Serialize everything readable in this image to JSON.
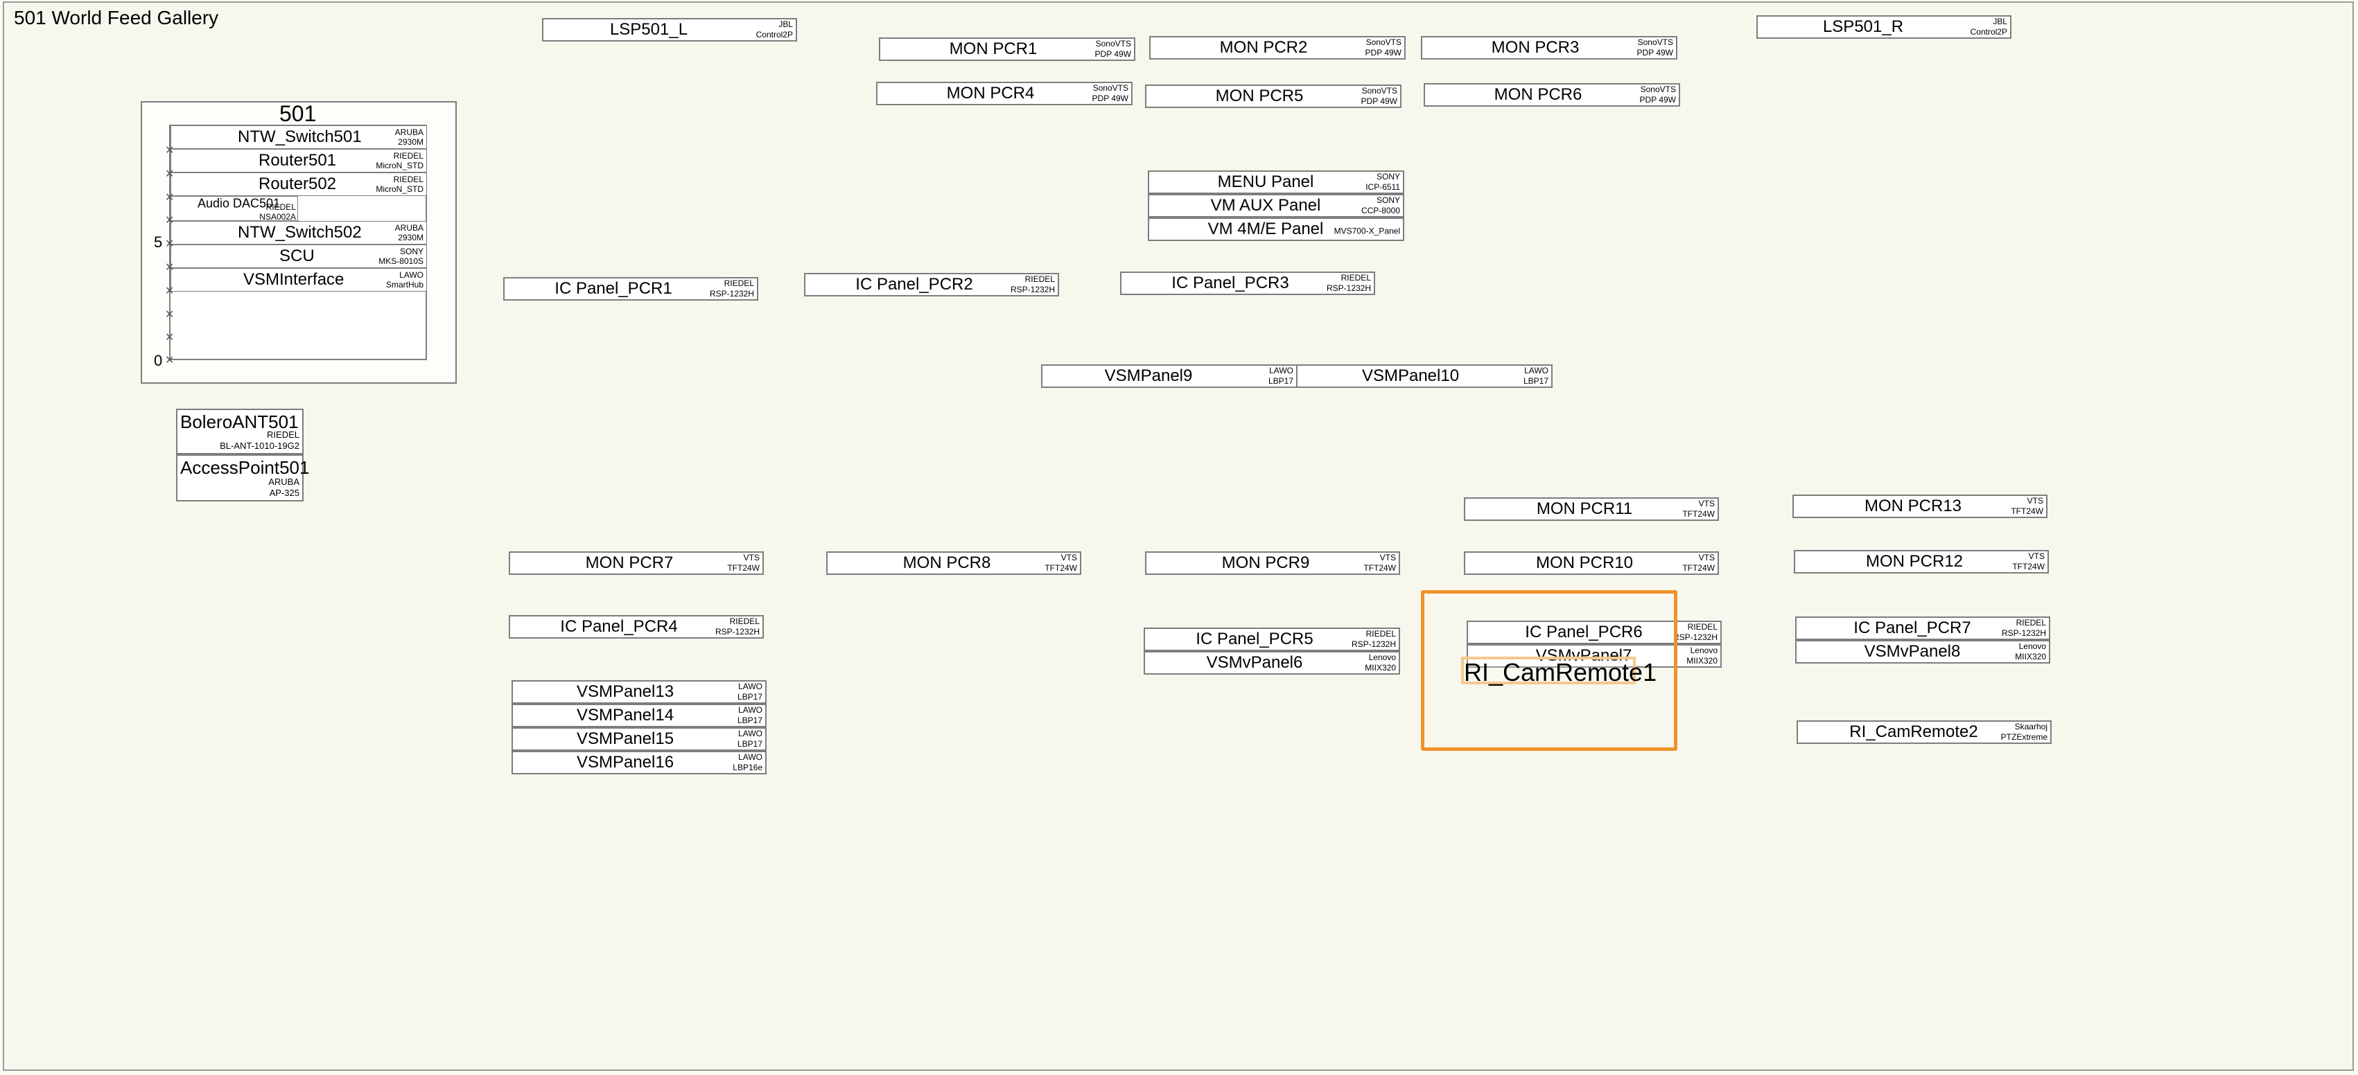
{
  "title": "501 World Feed Gallery",
  "accent_color": "#f0912c",
  "rack": {
    "title": "501",
    "units": [
      {
        "name": "NTW_Switch501",
        "mf1": "ARUBA",
        "mf2": "2930M"
      },
      {
        "name": "Router501",
        "mf1": "RIEDEL",
        "mf2": "MicroN_STD"
      },
      {
        "name": "Router502",
        "mf1": "RIEDEL",
        "mf2": "MicroN_STD"
      },
      {
        "name": "Audio DAC501",
        "mf1": "RIEDEL",
        "mf2": "NSA002A"
      },
      {
        "name": "NTW_Switch502",
        "mf1": "ARUBA",
        "mf2": "2930M"
      },
      {
        "name": "SCU",
        "mf1": "SONY",
        "mf2": "MKS-8010S"
      },
      {
        "name": "VSMInterface",
        "mf1": "LAWO",
        "mf2": "SmartHub"
      }
    ],
    "label_5": "5",
    "label_0": "0"
  },
  "devices": {
    "lsp_l": {
      "name": "LSP501_L",
      "mf1": "JBL",
      "mf2": "Control2P"
    },
    "lsp_r": {
      "name": "LSP501_R",
      "mf1": "JBL",
      "mf2": "Control2P"
    },
    "mon1": {
      "name": "MON PCR1",
      "mf1": "SonoVTS",
      "mf2": "PDP 49W"
    },
    "mon2": {
      "name": "MON PCR2",
      "mf1": "SonoVTS",
      "mf2": "PDP 49W"
    },
    "mon3": {
      "name": "MON PCR3",
      "mf1": "SonoVTS",
      "mf2": "PDP 49W"
    },
    "mon4": {
      "name": "MON PCR4",
      "mf1": "SonoVTS",
      "mf2": "PDP 49W"
    },
    "mon5": {
      "name": "MON PCR5",
      "mf1": "SonoVTS",
      "mf2": "PDP 49W"
    },
    "mon6": {
      "name": "MON PCR6",
      "mf1": "SonoVTS",
      "mf2": "PDP 49W"
    },
    "menu": {
      "name": "MENU Panel",
      "mf1": "SONY",
      "mf2": "ICP-6511"
    },
    "vmaux": {
      "name": "VM AUX Panel",
      "mf1": "SONY",
      "mf2": "CCP-8000"
    },
    "vm4me": {
      "name": "VM 4M/E Panel",
      "mf1": "",
      "mf2": "MVS700-X_Panel"
    },
    "ic1": {
      "name": "IC Panel_PCR1",
      "mf1": "RIEDEL",
      "mf2": "RSP-1232H"
    },
    "ic2": {
      "name": "IC Panel_PCR2",
      "mf1": "RIEDEL",
      "mf2": "RSP-1232H"
    },
    "ic3": {
      "name": "IC Panel_PCR3",
      "mf1": "RIEDEL",
      "mf2": "RSP-1232H"
    },
    "vsm9": {
      "name": "VSMPanel9",
      "mf1": "LAWO",
      "mf2": "LBP17"
    },
    "vsm10": {
      "name": "VSMPanel10",
      "mf1": "LAWO",
      "mf2": "LBP17"
    },
    "bolero": {
      "name": "BoleroANT501",
      "mf1": "RIEDEL",
      "mf2": "BL-ANT-1010-19G2"
    },
    "ap": {
      "name": "AccessPoint501",
      "mf1": "ARUBA",
      "mf2": "AP-325"
    },
    "mon11": {
      "name": "MON PCR11",
      "mf1": "VTS",
      "mf2": "TFT24W"
    },
    "mon13": {
      "name": "MON PCR13",
      "mf1": "VTS",
      "mf2": "TFT24W"
    },
    "mon7": {
      "name": "MON PCR7",
      "mf1": "VTS",
      "mf2": "TFT24W"
    },
    "mon8": {
      "name": "MON PCR8",
      "mf1": "VTS",
      "mf2": "TFT24W"
    },
    "mon9": {
      "name": "MON PCR9",
      "mf1": "VTS",
      "mf2": "TFT24W"
    },
    "mon10": {
      "name": "MON PCR10",
      "mf1": "VTS",
      "mf2": "TFT24W"
    },
    "mon12": {
      "name": "MON PCR12",
      "mf1": "VTS",
      "mf2": "TFT24W"
    },
    "ic4": {
      "name": "IC Panel_PCR4",
      "mf1": "RIEDEL",
      "mf2": "RSP-1232H"
    },
    "ic5": {
      "name": "IC Panel_PCR5",
      "mf1": "RIEDEL",
      "mf2": "RSP-1232H"
    },
    "vsmv6": {
      "name": "VSMvPanel6",
      "mf1": "Lenovo",
      "mf2": "MIIX320"
    },
    "ic6": {
      "name": "IC Panel_PCR6",
      "mf1": "RIEDEL",
      "mf2": "RSP-1232H"
    },
    "vsmv7": {
      "name": "VSMvPanel7",
      "mf1": "Lenovo",
      "mf2": "MIIX320"
    },
    "ic7": {
      "name": "IC Panel_PCR7",
      "mf1": "RIEDEL",
      "mf2": "RSP-1232H"
    },
    "vsmv8": {
      "name": "VSMvPanel8",
      "mf1": "Lenovo",
      "mf2": "MIIX320"
    },
    "vsm13": {
      "name": "VSMPanel13",
      "mf1": "LAWO",
      "mf2": "LBP17"
    },
    "vsm14": {
      "name": "VSMPanel14",
      "mf1": "LAWO",
      "mf2": "LBP17"
    },
    "vsm15": {
      "name": "VSMPanel15",
      "mf1": "LAWO",
      "mf2": "LBP17"
    },
    "vsm16": {
      "name": "VSMPanel16",
      "mf1": "LAWO",
      "mf2": "LBP16e"
    },
    "cam2": {
      "name": "RI_CamRemote2",
      "mf1": "Skaarhoj",
      "mf2": "PTZExtreme"
    }
  },
  "dragging": {
    "name": "RI_CamRemote1"
  }
}
